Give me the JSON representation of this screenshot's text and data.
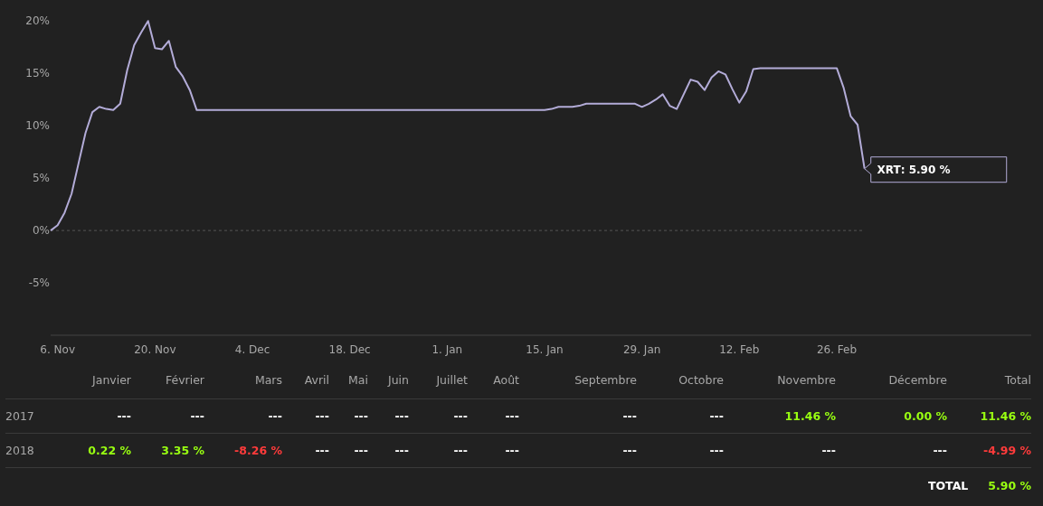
{
  "chart": {
    "chart_data": {
      "type": "line",
      "ylim": [
        -5,
        20
      ],
      "yticks": [
        {
          "value": 20,
          "label": "20%"
        },
        {
          "value": 15,
          "label": "15%"
        },
        {
          "value": 10,
          "label": "10%"
        },
        {
          "value": 5,
          "label": "5%"
        },
        {
          "value": 0,
          "label": "0%"
        },
        {
          "value": -5,
          "label": "-5%"
        }
      ],
      "categories": [
        null,
        "6. Nov",
        null,
        null,
        null,
        null,
        null,
        null,
        null,
        null,
        null,
        null,
        null,
        null,
        null,
        "20. Nov",
        null,
        null,
        null,
        null,
        null,
        null,
        null,
        null,
        null,
        null,
        null,
        null,
        null,
        "4. Dec",
        null,
        null,
        null,
        null,
        null,
        null,
        null,
        null,
        null,
        null,
        null,
        null,
        null,
        "18. Dec",
        null,
        null,
        null,
        null,
        null,
        null,
        null,
        null,
        null,
        null,
        null,
        null,
        null,
        "1. Jan",
        null,
        null,
        null,
        null,
        null,
        null,
        null,
        null,
        null,
        null,
        null,
        null,
        null,
        "15. Jan",
        null,
        null,
        null,
        null,
        null,
        null,
        null,
        null,
        null,
        null,
        null,
        null,
        null,
        "29. Jan",
        null,
        null,
        null,
        null,
        null,
        null,
        null,
        null,
        null,
        null,
        null,
        null,
        null,
        "12. Feb",
        null,
        null,
        null,
        null,
        null,
        null,
        null,
        null,
        null,
        null,
        null,
        null,
        null,
        "26. Feb",
        null,
        null,
        null,
        null
      ],
      "series": [
        {
          "name": "XRT",
          "color": "#b3acd8",
          "values": [
            0,
            0.5,
            1.7,
            3.5,
            6.4,
            9.3,
            11.3,
            11.8,
            11.6,
            11.5,
            12.1,
            15.3,
            17.7,
            18.9,
            20.0,
            17.4,
            17.3,
            18.1,
            15.6,
            14.7,
            13.4,
            11.5,
            11.5,
            11.5,
            11.5,
            11.5,
            11.5,
            11.5,
            11.5,
            11.5,
            11.5,
            11.5,
            11.5,
            11.5,
            11.5,
            11.5,
            11.5,
            11.5,
            11.5,
            11.5,
            11.5,
            11.5,
            11.5,
            11.5,
            11.5,
            11.5,
            11.5,
            11.5,
            11.5,
            11.5,
            11.5,
            11.5,
            11.5,
            11.5,
            11.5,
            11.5,
            11.5,
            11.5,
            11.5,
            11.5,
            11.5,
            11.5,
            11.5,
            11.5,
            11.5,
            11.5,
            11.5,
            11.5,
            11.5,
            11.5,
            11.5,
            11.5,
            11.6,
            11.8,
            11.8,
            11.8,
            11.9,
            12.1,
            12.1,
            12.1,
            12.1,
            12.1,
            12.1,
            12.1,
            12.1,
            11.8,
            12.1,
            12.5,
            13.0,
            11.9,
            11.6,
            13.0,
            14.4,
            14.2,
            13.4,
            14.6,
            15.2,
            14.9,
            13.5,
            12.2,
            13.3,
            15.4,
            15.5,
            15.5,
            15.5,
            15.5,
            15.5,
            15.5,
            15.5,
            15.5,
            15.5,
            15.5,
            15.5,
            15.5,
            13.6,
            10.9,
            10.1,
            5.9
          ]
        }
      ],
      "annotations": [
        {
          "text": ": 5.90 %"
        }
      ]
    }
  },
  "table": {
    "columns": [
      "Janvier",
      "Février",
      "Mars",
      "Avril",
      "Mai",
      "Juin",
      "Juillet",
      "Août",
      "Septembre",
      "Octobre",
      "Novembre",
      "Décembre",
      "Total"
    ],
    "rows": [
      {
        "year": "2017",
        "cells": [
          {
            "text": "---",
            "kind": "empty"
          },
          {
            "text": "---",
            "kind": "empty"
          },
          {
            "text": "---",
            "kind": "empty"
          },
          {
            "text": "---",
            "kind": "empty"
          },
          {
            "text": "---",
            "kind": "empty"
          },
          {
            "text": "---",
            "kind": "empty"
          },
          {
            "text": "---",
            "kind": "empty"
          },
          {
            "text": "---",
            "kind": "empty"
          },
          {
            "text": "---",
            "kind": "empty"
          },
          {
            "text": "---",
            "kind": "empty"
          },
          {
            "text": "11.46 %",
            "kind": "positive"
          },
          {
            "text": "0.00 %",
            "kind": "positive"
          },
          {
            "text": "11.46 %",
            "kind": "positive"
          }
        ]
      },
      {
        "year": "2018",
        "cells": [
          {
            "text": "0.22 %",
            "kind": "positive"
          },
          {
            "text": "3.35 %",
            "kind": "positive"
          },
          {
            "text": "-8.26 %",
            "kind": "negative"
          },
          {
            "text": "---",
            "kind": "empty"
          },
          {
            "text": "---",
            "kind": "empty"
          },
          {
            "text": "---",
            "kind": "empty"
          },
          {
            "text": "---",
            "kind": "empty"
          },
          {
            "text": "---",
            "kind": "empty"
          },
          {
            "text": "---",
            "kind": "empty"
          },
          {
            "text": "---",
            "kind": "empty"
          },
          {
            "text": "---",
            "kind": "empty"
          },
          {
            "text": "---",
            "kind": "empty"
          },
          {
            "text": "-4.99 %",
            "kind": "negative"
          }
        ]
      }
    ],
    "total": {
      "label": "TOTAL",
      "value": "5.90 %",
      "kind": "positive"
    }
  }
}
